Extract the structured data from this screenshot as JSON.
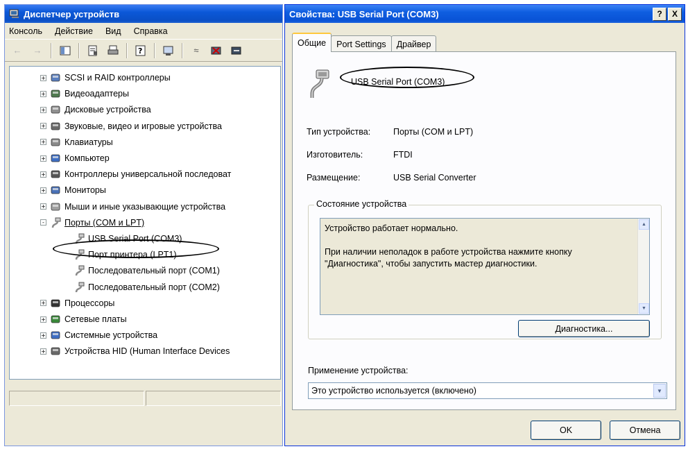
{
  "device_manager": {
    "title": "Диспетчер устройств",
    "menu": [
      "Консоль",
      "Действие",
      "Вид",
      "Справка"
    ],
    "toolbar_icons": [
      "back-arrow-icon",
      "forward-arrow-icon",
      "show-hide-tree-icon",
      "properties-icon",
      "print-icon",
      "help-icon",
      "scan-hardware-icon",
      "update-driver-icon",
      "uninstall-icon",
      "disable-icon"
    ],
    "tree": [
      {
        "label": "SCSI и RAID контроллеры",
        "icon": "scsi-icon",
        "expander": "+"
      },
      {
        "label": "Видеоадаптеры",
        "icon": "display-adapter-icon",
        "expander": "+"
      },
      {
        "label": "Дисковые устройства",
        "icon": "disk-drive-icon",
        "expander": "+"
      },
      {
        "label": "Звуковые, видео и игровые устройства",
        "icon": "sound-icon",
        "expander": "+"
      },
      {
        "label": "Клавиатуры",
        "icon": "keyboard-icon",
        "expander": "+"
      },
      {
        "label": "Компьютер",
        "icon": "computer-icon",
        "expander": "+"
      },
      {
        "label": "Контроллеры универсальной последоват",
        "icon": "usb-controller-icon",
        "expander": "+"
      },
      {
        "label": "Мониторы",
        "icon": "monitor-icon",
        "expander": "+"
      },
      {
        "label": "Мыши и иные указывающие устройства",
        "icon": "mouse-icon",
        "expander": "+"
      },
      {
        "label": "Порты (COM и LPT)",
        "icon": "port-icon",
        "expander": "-"
      },
      {
        "label": "USB Serial Port (COM3)",
        "icon": "port-connector-icon",
        "child": true
      },
      {
        "label": "Порт принтера (LPT1)",
        "icon": "port-connector-icon",
        "child": true
      },
      {
        "label": "Последовательный порт (COM1)",
        "icon": "port-connector-icon",
        "child": true
      },
      {
        "label": "Последовательный порт (COM2)",
        "icon": "port-connector-icon",
        "child": true
      },
      {
        "label": "Процессоры",
        "icon": "processor-icon",
        "expander": "+"
      },
      {
        "label": "Сетевые платы",
        "icon": "network-card-icon",
        "expander": "+"
      },
      {
        "label": "Системные устройства",
        "icon": "system-device-icon",
        "expander": "+"
      },
      {
        "label": "Устройства HID (Human Interface Devices",
        "icon": "hid-icon",
        "expander": "+"
      }
    ]
  },
  "dialog": {
    "title": "Свойства: USB Serial Port (COM3)",
    "title_buttons": [
      "?",
      "X"
    ],
    "tabs": [
      "Общие",
      "Port Settings",
      "Драйвер"
    ],
    "device_name": "USB Serial Port (COM3)",
    "fields": [
      {
        "label": "Тип устройства:",
        "value": "Порты (COM и LPT)"
      },
      {
        "label": "Изготовитель:",
        "value": "FTDI"
      },
      {
        "label": "Размещение:",
        "value": "USB Serial Converter"
      }
    ],
    "status_group_title": "Состояние устройства",
    "status_line1": "Устройство работает нормально.",
    "status_line2": "При наличии неполадок в работе устройства нажмите кнопку \"Диагностика\", чтобы запустить мастер диагностики.",
    "diagnostics_button": "Диагностика...",
    "usage_label": "Применение устройства:",
    "usage_value": "Это устройство используется (включено)",
    "ok_button": "OK",
    "cancel_button": "Отмена"
  }
}
